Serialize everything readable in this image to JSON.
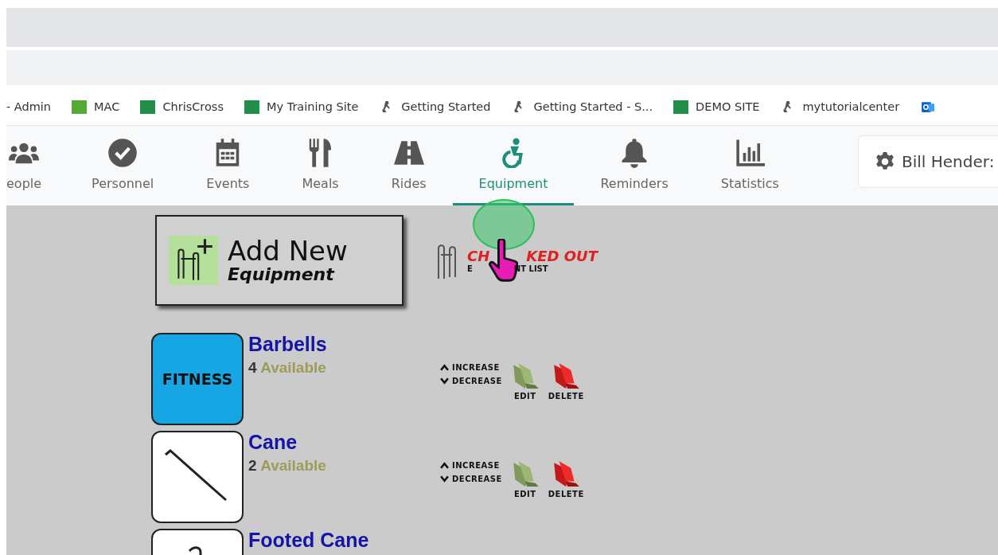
{
  "bookmarks": [
    {
      "label": "- Admin",
      "kind": "plain"
    },
    {
      "label": "MAC",
      "kind": "my"
    },
    {
      "label": "ChrisCross",
      "kind": "m"
    },
    {
      "label": "My Training Site",
      "kind": "m"
    },
    {
      "label": "Getting Started",
      "kind": "hiker"
    },
    {
      "label": "Getting Started - S...",
      "kind": "hiker"
    },
    {
      "label": "DEMO SITE",
      "kind": "m"
    },
    {
      "label": "mytutorialcenter",
      "kind": "hiker"
    },
    {
      "kind": "outlook"
    }
  ],
  "nav": [
    {
      "label": "eople",
      "selected": false
    },
    {
      "label": "Personnel",
      "selected": false
    },
    {
      "label": "Events",
      "selected": false
    },
    {
      "label": "Meals",
      "selected": false
    },
    {
      "label": "Rides",
      "selected": false
    },
    {
      "label": "Equipment",
      "selected": true
    },
    {
      "label": "Reminders",
      "selected": false
    },
    {
      "label": "Statistics",
      "selected": false
    }
  ],
  "user": {
    "name": "Bill Hender:"
  },
  "add_button": {
    "line_1": "Add New",
    "line_2": "Equipment"
  },
  "checked_out": {
    "title_parts": [
      "CH",
      "KED OUT"
    ],
    "subtitle_parts": [
      "E",
      "NT LIST"
    ]
  },
  "items": [
    {
      "name": "Barbells",
      "count": "4",
      "status": "Available",
      "kind": "tile",
      "thumb_text": "FITNESS",
      "increase": "INCREASE",
      "decrease": "DECREASE",
      "edit": "EDIT",
      "delete": "DELETE"
    },
    {
      "name": "Cane",
      "count": "2",
      "status": "Available",
      "kind": "cane",
      "increase": "INCREASE",
      "decrease": "DECREASE",
      "edit": "EDIT",
      "delete": "DELETE"
    },
    {
      "name": "Footed Cane",
      "kind": "footed-cane"
    }
  ]
}
